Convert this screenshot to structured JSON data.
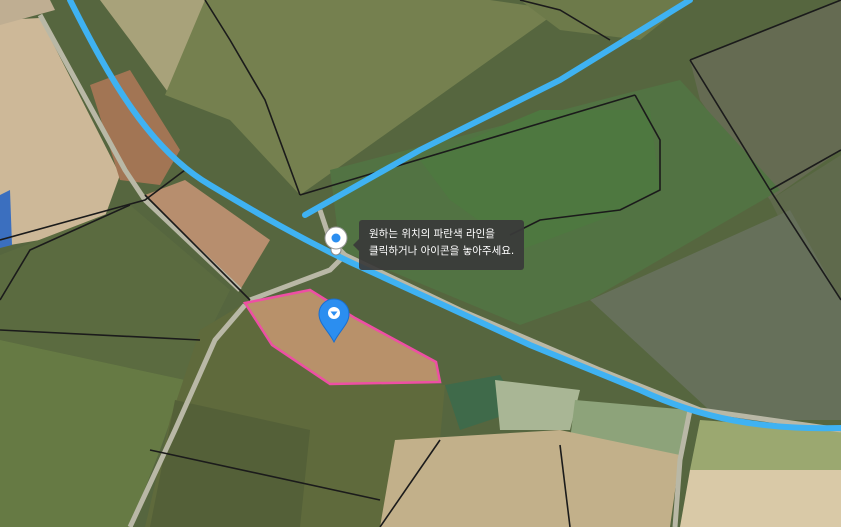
{
  "map": {
    "tooltip": {
      "line1": "원하는 위치의 파란색 라인을",
      "line2": "클릭하거나 아이콘을 놓아주세요."
    },
    "icons": {
      "route_node": "route-node-icon",
      "location_pin": "location-pin-icon"
    },
    "colors": {
      "route_line": "#3fb2f2",
      "parcel_outline": "#ee4fa4",
      "pin": "#2b8ef0",
      "tooltip_bg": "#3a3a3a"
    }
  }
}
